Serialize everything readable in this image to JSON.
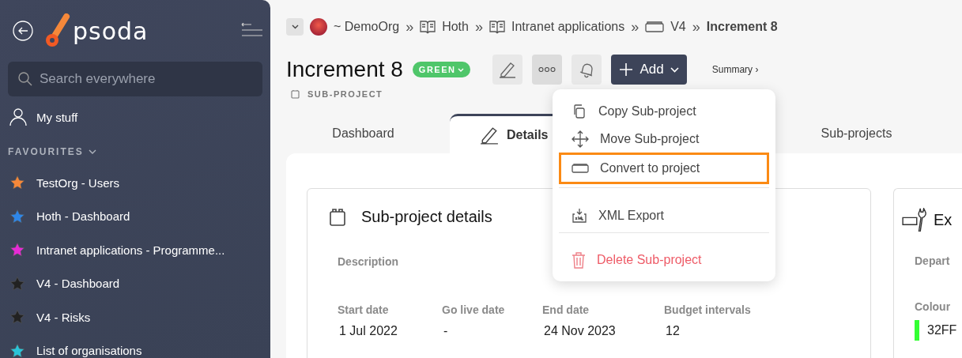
{
  "sidebar": {
    "logo_text": "psoda",
    "search": {
      "placeholder": "Search everywhere"
    },
    "my_stuff": "My stuff",
    "favourites_heading": "FAVOURITES",
    "favourites": [
      {
        "label": "TestOrg - Users",
        "color": "#f5883a"
      },
      {
        "label": "Hoth - Dashboard",
        "color": "#2e86e8"
      },
      {
        "label": "Intranet applications - Programme...",
        "color": "#e62bd6"
      },
      {
        "label": "V4 - Dashboard",
        "color": "#222222"
      },
      {
        "label": "V4 - Risks",
        "color": "#222222"
      },
      {
        "label": "List of organisations",
        "color": "#2bc4d9"
      }
    ]
  },
  "breadcrumbs": [
    {
      "label": "~ DemoOrg",
      "kind": "org"
    },
    {
      "separator": "»",
      "label": "Hoth",
      "kind": "book"
    },
    {
      "separator": "»",
      "label": "Intranet applications",
      "kind": "book"
    },
    {
      "separator": "»",
      "label": "V4",
      "kind": "project"
    },
    {
      "separator": "»",
      "label": "Increment 8",
      "kind": "current"
    }
  ],
  "header": {
    "title": "Increment 8",
    "status": "GREEN",
    "type_label": "SUB-PROJECT",
    "add_button": "Add",
    "summary_link": "Summary ›"
  },
  "tabs": [
    {
      "label": "Dashboard",
      "selected": false
    },
    {
      "label": "Details",
      "selected": true
    },
    {
      "label": "Sub-projects",
      "selected": false
    }
  ],
  "menu": [
    {
      "label": "Copy Sub-project",
      "kind": "copy",
      "highlighted": false
    },
    {
      "label": "Move Sub-project",
      "kind": "move",
      "highlighted": false
    },
    {
      "label": "Convert to project",
      "kind": "convert",
      "highlighted": true
    },
    {
      "label": "XML Export",
      "kind": "xml",
      "highlighted": false
    },
    {
      "label": "Delete Sub-project",
      "kind": "delete",
      "highlighted": false
    }
  ],
  "details_card": {
    "title": "Sub-project details",
    "description_label": "Description",
    "fields": [
      {
        "label": "Start date",
        "value": "1 Jul 2022"
      },
      {
        "label": "Go live date",
        "value": "-"
      },
      {
        "label": "End date",
        "value": "24 Nov 2023"
      },
      {
        "label": "Budget intervals",
        "value": "12"
      }
    ]
  },
  "extra_card": {
    "title": "Ex",
    "department_label": "Depart",
    "colour_label": "Colour",
    "colour_value": "32FF",
    "color": "#33ff33"
  }
}
